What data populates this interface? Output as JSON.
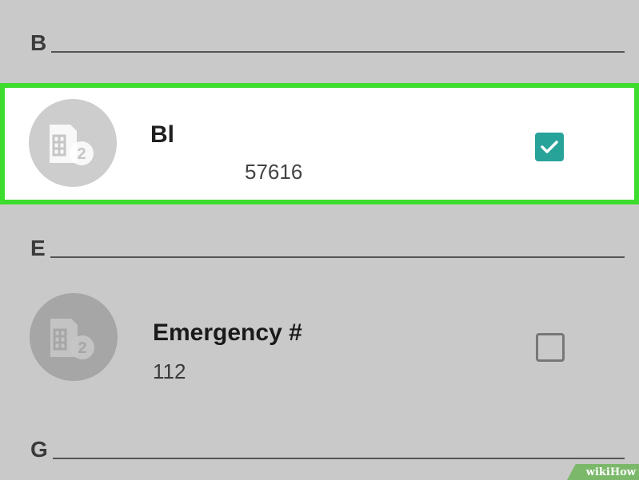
{
  "sections": {
    "b": {
      "letter": "B"
    },
    "e": {
      "letter": "E"
    },
    "g": {
      "letter": "G"
    }
  },
  "contacts": [
    {
      "name": "Bl",
      "number": "57616",
      "checked": true,
      "avatar_badge": "2"
    },
    {
      "name": "Emergency #",
      "number": "112",
      "checked": false,
      "avatar_badge": "2"
    }
  ],
  "icons": {
    "avatar": "sim-card-2-icon",
    "checked": "checkmark-icon"
  },
  "colors": {
    "background": "#c9c9c9",
    "highlight_border": "#3ddc2e",
    "checkbox_checked": "#27a39a",
    "selected_row_bg": "#ffffff"
  },
  "watermark": {
    "text": "wikiHow"
  }
}
